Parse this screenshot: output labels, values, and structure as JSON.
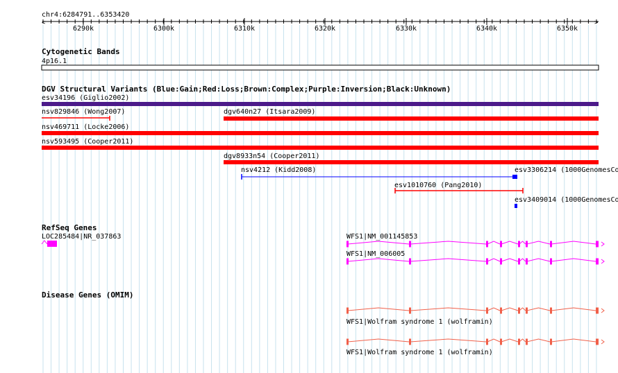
{
  "header": {
    "region": "chr4:6284791..6353420",
    "ruler_ticks": [
      "6290k",
      "6300k",
      "6310k",
      "6320k",
      "6330k",
      "6340k",
      "6350k"
    ]
  },
  "tracks": {
    "cytogenetic": {
      "title": "Cytogenetic Bands",
      "band": "4p16.1"
    },
    "dgv": {
      "title": "DGV Structural Variants (Blue:Gain;Red:Loss;Brown:Complex;Purple:Inversion;Black:Unknown)",
      "features": [
        {
          "label": "esv34196 (Giglio2002)",
          "color": "#4b1a8a"
        },
        {
          "label": "nsv829846 (Wong2007)",
          "color": "#ff0000"
        },
        {
          "label": "dgv640n27 (Itsara2009)",
          "color": "#ff0000"
        },
        {
          "label": "nsv469711 (Locke2006)",
          "color": "#ff0000"
        },
        {
          "label": "nsv593495 (Cooper2011)",
          "color": "#ff0000"
        },
        {
          "label": "dgv8933n54 (Cooper2011)",
          "color": "#ff0000"
        },
        {
          "label": "nsv4212 (Kidd2008)",
          "color": "#0000ff"
        },
        {
          "label": "esv3306214 (1000GenomesCo",
          "color": "#0000ff"
        },
        {
          "label": "esv1010760 (Pang2010)",
          "color": "#ff0000"
        },
        {
          "label": "esv3409014 (1000GenomesCo",
          "color": "#0000ff"
        }
      ]
    },
    "refseq": {
      "title": "RefSeq Genes",
      "genes": [
        {
          "label": "LOC285484|NR_037863",
          "color": "#ff00ff"
        },
        {
          "label": "WFS1|NM_001145853",
          "color": "#ff00ff"
        },
        {
          "label": "WFS1|NM_006005",
          "color": "#ff00ff"
        }
      ]
    },
    "omim": {
      "title": "Disease Genes (OMIM)",
      "genes": [
        {
          "label": "WFS1|Wolfram syndrome 1 (wolframin)",
          "color": "#f0604a"
        },
        {
          "label": "WFS1|Wolfram syndrome 1 (wolframin)",
          "color": "#f0604a"
        }
      ]
    }
  }
}
